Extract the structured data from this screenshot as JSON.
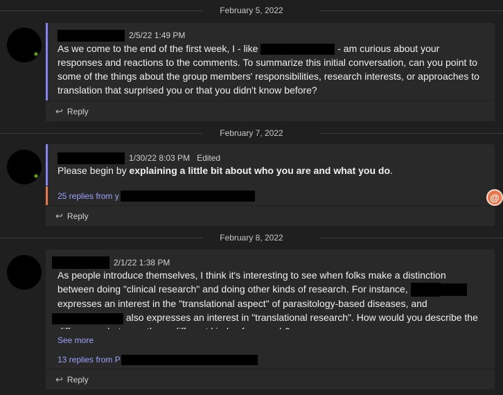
{
  "dividers": [
    "February 5, 2022",
    "February 7, 2022",
    "February 8, 2022"
  ],
  "messages": [
    {
      "timestamp": "2/5/22 1:49 PM",
      "text_a": "As we come to the end of the first week, I - like",
      "text_b": "- am curious about your responses and reactions to the comments. To summarize this initial conversation, can you point to some of the things about the group members' responsibilities, research interests, or approaches to translation that surprised you or that you didn't know before?",
      "reply_label": "Reply"
    },
    {
      "timestamp": "1/30/22 8:03 PM",
      "edited": "Edited",
      "text_a": "Please begin by",
      "text_bold": "explaining a little bit about who you are and what you do",
      "text_end": ".",
      "replies_label": "25 replies from y",
      "reply_label": "Reply"
    },
    {
      "timestamp": "2/1/22 1:38 PM",
      "text_a": "As people introduce themselves, I think it's interesting to see when folks make a distinction between doing \"clinical research\" and doing other kinds of research. For instance,",
      "text_b": "expresses an interest in the \"translational aspect\" of parasitology-based diseases, and",
      "text_c": "also expresses an interest in \"translational research\". How would you describe the differences between these different kinds of research?",
      "see_more": "See more",
      "replies_label": "13 replies from P",
      "reply_label": "Reply"
    }
  ],
  "icons": {
    "reply": "reply-arrow-icon",
    "mention": "at-mention-icon"
  },
  "colors": {
    "accent": "#7f85f5",
    "link": "#9da2ff",
    "mention": "#e97548",
    "background": "#1f1f1f",
    "card": "#292929"
  }
}
